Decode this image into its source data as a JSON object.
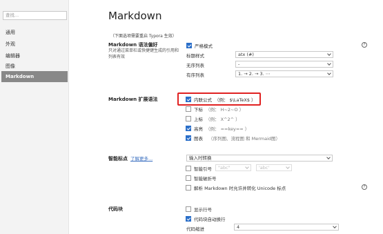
{
  "sidebar": {
    "search_placeholder": "查找...",
    "items": [
      {
        "label": "通用"
      },
      {
        "label": "外观"
      },
      {
        "label": "编辑器"
      },
      {
        "label": "图像"
      },
      {
        "label": "Markdown",
        "active": true
      }
    ]
  },
  "main": {
    "title": "Markdown",
    "restart_note": "（下面选项需要重启 Typora 生效）",
    "syntax_pref": {
      "title": "Markdown 语法偏好",
      "desc": "只对通过菜单栏或快捷键生成的引用和列表有效",
      "strict_mode": "严格模式",
      "strict_checked": true,
      "header_style_label": "标题样式",
      "header_style_value": "atx (#)",
      "unordered_label": "无序列表",
      "unordered_value": "-",
      "ordered_label": "有序列表",
      "ordered_value": "1. → 2. → 3. ⋯"
    },
    "extended": {
      "title": "Markdown 扩展语法",
      "items": [
        {
          "label": "内联公式",
          "hint": "（例： $\\LaTeX$ ）",
          "checked": true
        },
        {
          "label": "下标",
          "hint": "（例： H~2~O ）",
          "checked": false
        },
        {
          "label": "上标",
          "hint": "（例： X^2^ ）",
          "checked": false
        },
        {
          "label": "高亮",
          "hint": "（例： ==key== ）",
          "checked": true
        },
        {
          "label": "图表",
          "hint": "（序列图、流程图 和 Mermaid图）",
          "checked": true
        }
      ]
    },
    "smart": {
      "title": "智能标点",
      "learn_more": "了解更多...",
      "mode_value": "输入时转换",
      "smart_quotes": "智能引号",
      "smart_quotes_checked": false,
      "quote_double": "\"abc\"",
      "quote_single": "'abc'",
      "smart_dashes": "智能破折号",
      "smart_dashes_checked": false,
      "unicode_punct": "解析 Markdown 时允许并转化 Unicode 标点",
      "unicode_punct_checked": false
    },
    "code": {
      "title": "代码块",
      "line_numbers": "显示行号",
      "line_numbers_checked": false,
      "wrap": "代码块自动换行",
      "wrap_checked": true,
      "indent_label": "代码缩进",
      "indent_value": "4"
    },
    "help_glyph": "?"
  }
}
